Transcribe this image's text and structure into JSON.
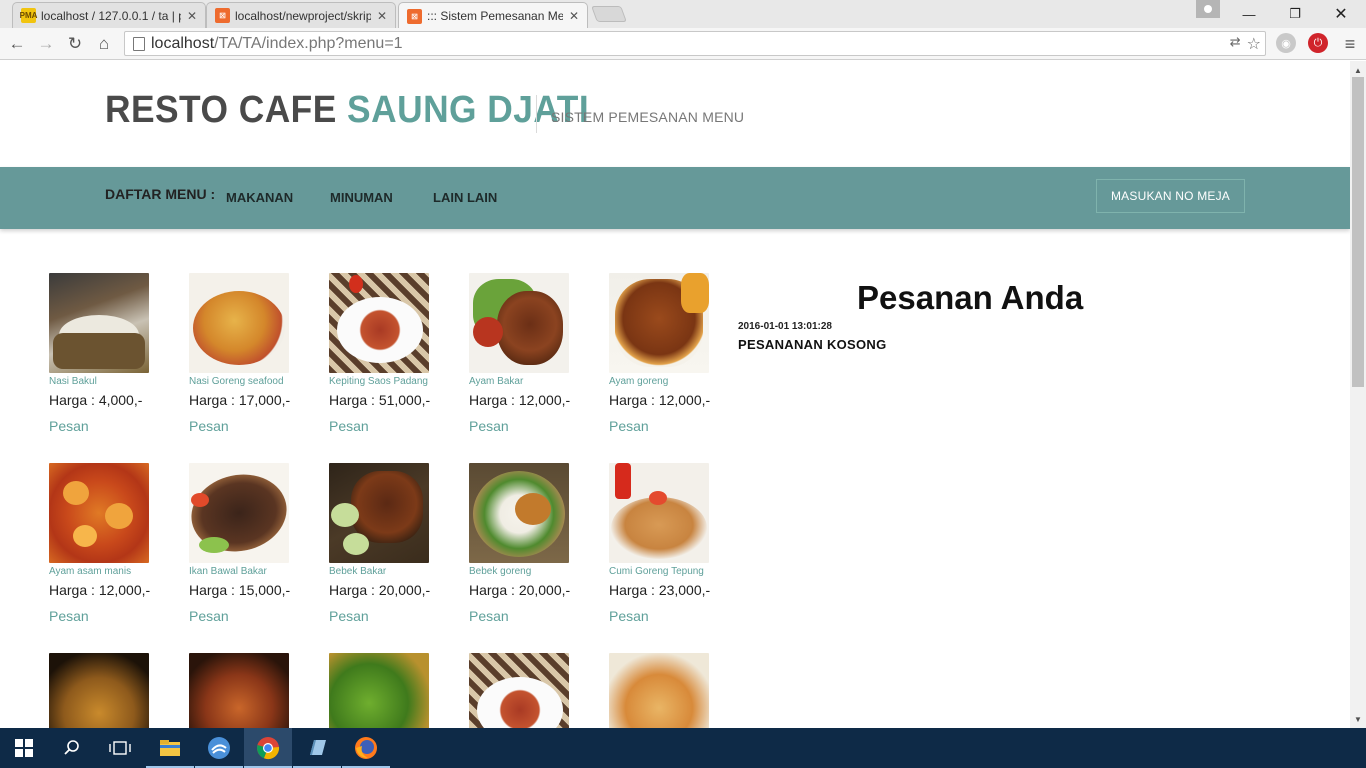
{
  "browser": {
    "tabs": [
      {
        "title": "localhost / 127.0.0.1 / ta | p",
        "icon": "phpmyadmin-favicon"
      },
      {
        "title": "localhost/newproject/skrip",
        "icon": "xampp-favicon"
      },
      {
        "title": "::: Sistem Pemesanan Menu",
        "icon": "xampp-favicon"
      }
    ],
    "url_host": "localhost",
    "url_path": "/TA/TA/index.php?menu=1"
  },
  "site": {
    "brand_part1": "RESTO CAFE",
    "brand_part2": "SAUNG DJATI",
    "tagline": "SISTEM PEMESANAN MENU",
    "colors": {
      "accent": "#5fa09a",
      "navbar": "#669999"
    }
  },
  "nav": {
    "label": "DAFTAR MENU :",
    "items": [
      "MAKANAN",
      "MINUMAN",
      "LAIN LAIN"
    ],
    "table_button": "MASUKAN NO MEJA"
  },
  "menu": {
    "price_prefix": "Harga : ",
    "order_label": "Pesan",
    "items": [
      {
        "name": "Nasi Bakul",
        "price": "4,000,-"
      },
      {
        "name": "Nasi Goreng seafood",
        "price": "17,000,-"
      },
      {
        "name": "Kepiting Saos Padang",
        "price": "51,000,-"
      },
      {
        "name": "Ayam Bakar",
        "price": "12,000,-"
      },
      {
        "name": "Ayam goreng",
        "price": "12,000,-"
      },
      {
        "name": "Ayam asam manis",
        "price": "12,000,-"
      },
      {
        "name": "Ikan Bawal Bakar",
        "price": "15,000,-"
      },
      {
        "name": "Bebek Bakar",
        "price": "20,000,-"
      },
      {
        "name": "Bebek goreng",
        "price": "20,000,-"
      },
      {
        "name": "Cumi Goreng Tepung",
        "price": "23,000,-"
      }
    ]
  },
  "order": {
    "title": "Pesanan Anda",
    "timestamp": "2016-01-01 13:01:28",
    "status": "PESANANAN KOSONG"
  }
}
